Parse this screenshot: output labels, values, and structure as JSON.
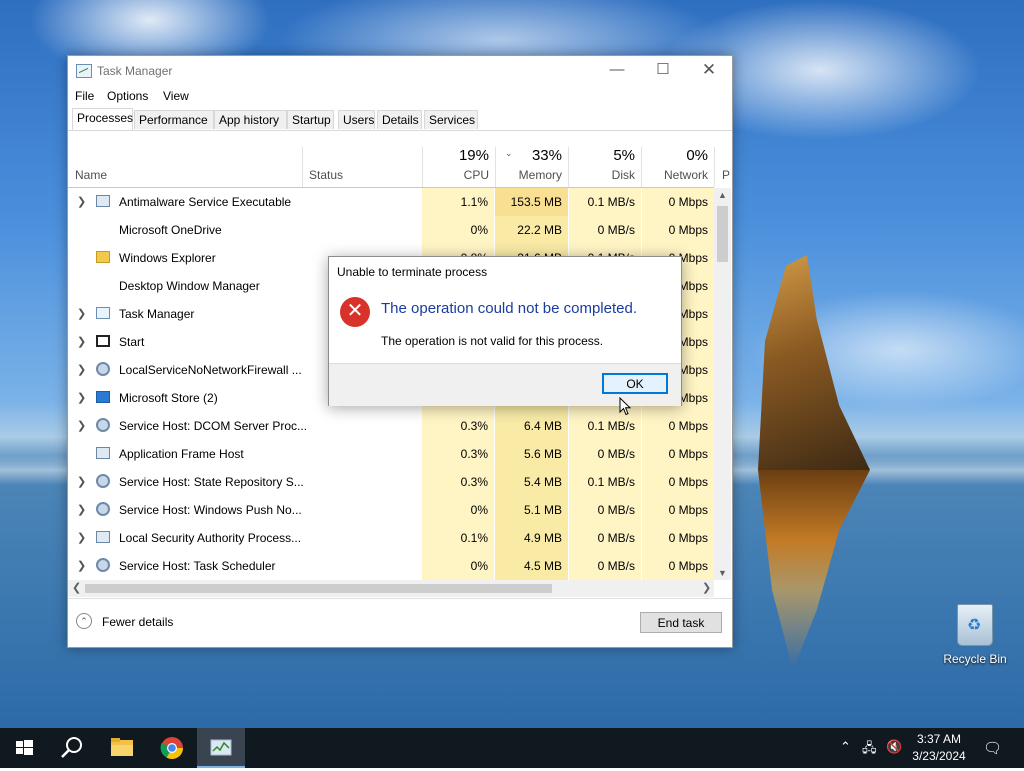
{
  "window": {
    "title": "Task Manager",
    "menu": [
      "File",
      "Options",
      "View"
    ],
    "tabs": [
      "Processes",
      "Performance",
      "App history",
      "Startup",
      "Users",
      "Details",
      "Services"
    ],
    "active_tab": "Processes"
  },
  "columns": {
    "name": "Name",
    "status": "Status",
    "cpu": {
      "pct": "19%",
      "label": "CPU"
    },
    "memory": {
      "pct": "33%",
      "label": "Memory"
    },
    "disk": {
      "pct": "5%",
      "label": "Disk"
    },
    "network": {
      "pct": "0%",
      "label": "Network"
    },
    "power_partial": "P"
  },
  "processes": [
    {
      "name": "Antimalware Service Executable",
      "cpu": "1.1%",
      "mem": "153.5 MB",
      "disk": "0.1 MB/s",
      "net": "0 Mbps"
    },
    {
      "name": "Microsoft OneDrive",
      "cpu": "0%",
      "mem": "22.2 MB",
      "disk": "0 MB/s",
      "net": "0 Mbps"
    },
    {
      "name": "Windows Explorer",
      "cpu": "0.8%",
      "mem": "21.6 MB",
      "disk": "0.1 MB/s",
      "net": "0 Mbps"
    },
    {
      "name": "Desktop Window Manager",
      "cpu": "",
      "mem": "",
      "disk": "",
      "net": "0 Mbps"
    },
    {
      "name": "Task Manager",
      "cpu": "",
      "mem": "",
      "disk": "",
      "net": "0 Mbps"
    },
    {
      "name": "Start",
      "cpu": "",
      "mem": "",
      "disk": "",
      "net": "0 Mbps"
    },
    {
      "name": "LocalServiceNoNetworkFirewall ...",
      "cpu": "",
      "mem": "",
      "disk": "",
      "net": "0 Mbps"
    },
    {
      "name": "Microsoft Store (2)",
      "cpu": "",
      "mem": "",
      "disk": "",
      "net": "0 Mbps"
    },
    {
      "name": "Service Host: DCOM Server Proc...",
      "cpu": "0.3%",
      "mem": "6.4 MB",
      "disk": "0.1 MB/s",
      "net": "0 Mbps"
    },
    {
      "name": "Application Frame Host",
      "cpu": "0.3%",
      "mem": "5.6 MB",
      "disk": "0 MB/s",
      "net": "0 Mbps"
    },
    {
      "name": "Service Host: State Repository S...",
      "cpu": "0.3%",
      "mem": "5.4 MB",
      "disk": "0.1 MB/s",
      "net": "0 Mbps"
    },
    {
      "name": "Service Host: Windows Push No...",
      "cpu": "0%",
      "mem": "5.1 MB",
      "disk": "0 MB/s",
      "net": "0 Mbps"
    },
    {
      "name": "Local Security Authority Process...",
      "cpu": "0.1%",
      "mem": "4.9 MB",
      "disk": "0 MB/s",
      "net": "0 Mbps"
    },
    {
      "name": "Service Host: Task Scheduler",
      "cpu": "0%",
      "mem": "4.5 MB",
      "disk": "0 MB/s",
      "net": "0 Mbps"
    }
  ],
  "footer": {
    "fewer_details": "Fewer details",
    "end_task": "End task"
  },
  "dialog": {
    "title": "Unable to terminate process",
    "main": "The operation could not be completed.",
    "sub": "The operation is not valid for this process.",
    "ok": "OK"
  },
  "desktop": {
    "recycle_bin": "Recycle Bin"
  },
  "taskbar": {
    "time": "3:37 AM",
    "date": "3/23/2024"
  }
}
